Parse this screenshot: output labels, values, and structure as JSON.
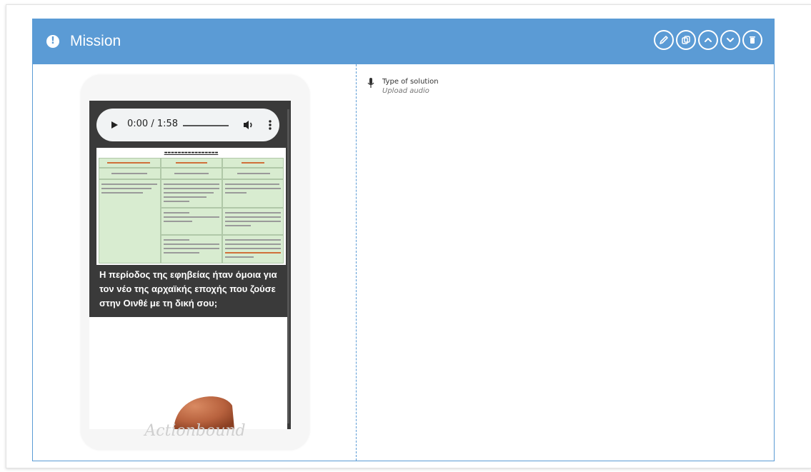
{
  "mission": {
    "title": "Mission",
    "header_color": "#5b9bd5",
    "actions": [
      {
        "name": "edit",
        "icon": "pencil-icon"
      },
      {
        "name": "duplicate",
        "icon": "copy-icon"
      },
      {
        "name": "move-up",
        "icon": "chevron-up-icon"
      },
      {
        "name": "move-down",
        "icon": "chevron-down-icon"
      },
      {
        "name": "delete",
        "icon": "trash-icon"
      }
    ]
  },
  "preview": {
    "audio": {
      "time": "0:00 / 1:58"
    },
    "question": "Η περίοδος της εφηβείας ήταν όμοια για τον νέο της αρχαϊκής εποχής που ζούσε στην Οινθέ με τη δική σου;",
    "watermark": "Actionbound"
  },
  "solution": {
    "label": "Type of solution",
    "value": "Upload audio"
  }
}
